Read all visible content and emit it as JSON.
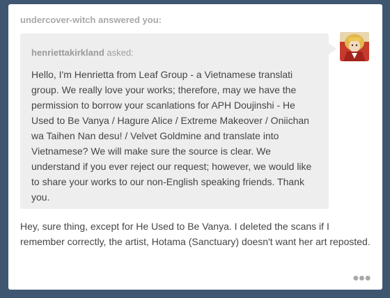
{
  "post": {
    "answerer_line": "undercover-witch answered you:",
    "asker_name": "henriettakirkland",
    "asked_label": " asked:",
    "question": "Hello, I'm Henrietta from Leaf Group - a Vietnamese translati group. We really love your works; therefore, may we have the permission to borrow your scanlations for APH Doujinshi - He Used to Be Vanya / Hagure Alice / Extreme Makeover / Oniichan wa Taihen Nan desu! / Velvet Goldmine and translate into Vietnamese? We will make sure the source is clear. We understand if you ever reject our request; however, we would like to share your works to our non-English speaking friends. Thank you.",
    "answer": "Hey, sure thing, except for He Used to Be Vanya. I deleted the scans if I remember correctly, the artist, Hotama (Sanctuary) doesn't want her art reposted.",
    "menu_icon": "more-dots-icon"
  },
  "colors": {
    "page_background": "#3f5671",
    "card_background": "#ffffff",
    "bubble_background": "#eeeeee",
    "header_text": "#a8a8a8",
    "body_text": "#444444"
  }
}
